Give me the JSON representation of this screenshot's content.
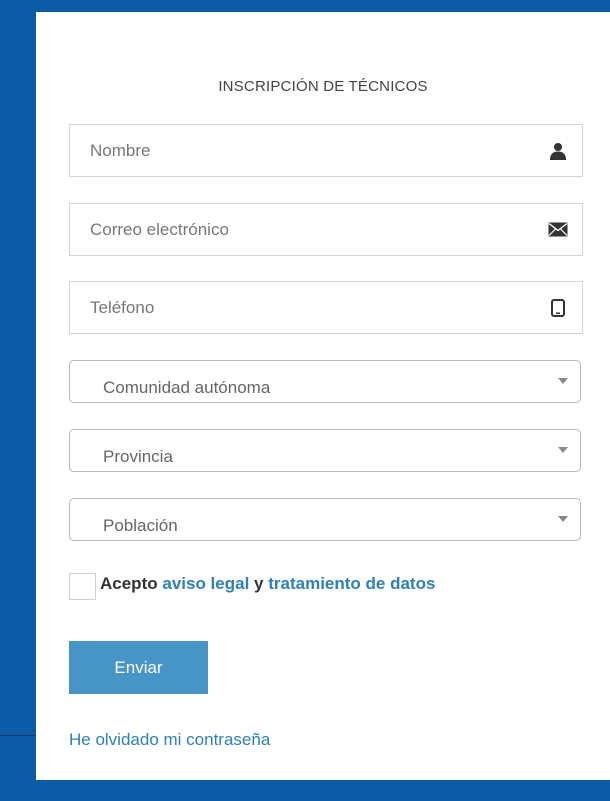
{
  "form": {
    "title": "INSCRIPCIÓN DE TÉCNICOS",
    "fields": [
      {
        "placeholder": "Nombre",
        "icon": "user-icon"
      },
      {
        "placeholder": "Correo electrónico",
        "icon": "envelope-icon"
      },
      {
        "placeholder": "Teléfono",
        "icon": "mobile-phone-icon"
      }
    ],
    "selects": [
      {
        "selected": "Comunidad autónoma"
      },
      {
        "selected": "Provincia"
      },
      {
        "selected": "Población"
      }
    ],
    "consent": {
      "prefix": "Acepto",
      "link_legal": "aviso legal",
      "conjunction": "y",
      "link_data": "tratamiento de datos",
      "checked": false
    },
    "submit_label": "Enviar",
    "forgot_password": "He olvidado mi contraseña"
  },
  "colors": {
    "frame_blue": "#0d5aa7",
    "button_blue": "#4695c6",
    "link_blue": "#2f7fb8"
  }
}
